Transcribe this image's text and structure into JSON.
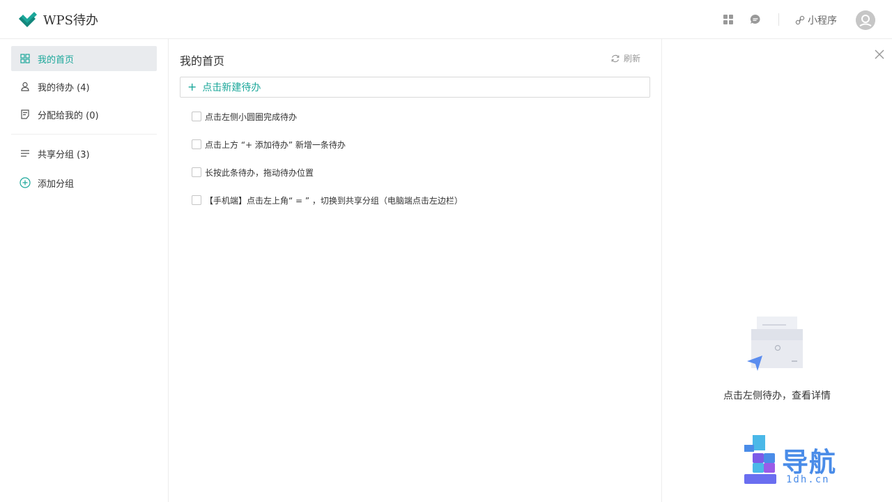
{
  "app": {
    "name": "WPS待办",
    "brand_color": "#1ba79a"
  },
  "header": {
    "icons": [
      "apps-grid-icon",
      "chat-bubble-icon"
    ],
    "mini_program_label": "小程序",
    "avatar_icon": "user-avatar-icon"
  },
  "sidebar": {
    "items": [
      {
        "label": "我的首页",
        "icon": "grid-icon",
        "active": true
      },
      {
        "label": "我的待办 (4)",
        "icon": "person-icon",
        "active": false
      },
      {
        "label": "分配给我的 (0)",
        "icon": "assign-doc-icon",
        "active": false
      }
    ],
    "groups": [
      {
        "label": "共享分组 (3)",
        "icon": "list-lines-icon"
      },
      {
        "label": "添加分组",
        "icon": "add-circle-icon"
      }
    ]
  },
  "main": {
    "title": "我的首页",
    "refresh_label": "刷新",
    "new_todo_label": "点击新建待办",
    "todos": [
      {
        "text": "点击左侧小圆圈完成待办",
        "done": false
      },
      {
        "text": "点击上方 “+ 添加待办” 新增一条待办",
        "done": false
      },
      {
        "text": "长按此条待办，拖动待办位置",
        "done": false
      },
      {
        "text": "【手机端】点击左上角“ = ” ，切换到共享分组（电脑端点击左边栏）",
        "done": false
      }
    ]
  },
  "detail": {
    "empty_hint": "点击左侧待办，查看详情",
    "close_icon": "close-icon"
  },
  "watermark": {
    "title": "导航",
    "subtitle": "1dh.cn"
  }
}
